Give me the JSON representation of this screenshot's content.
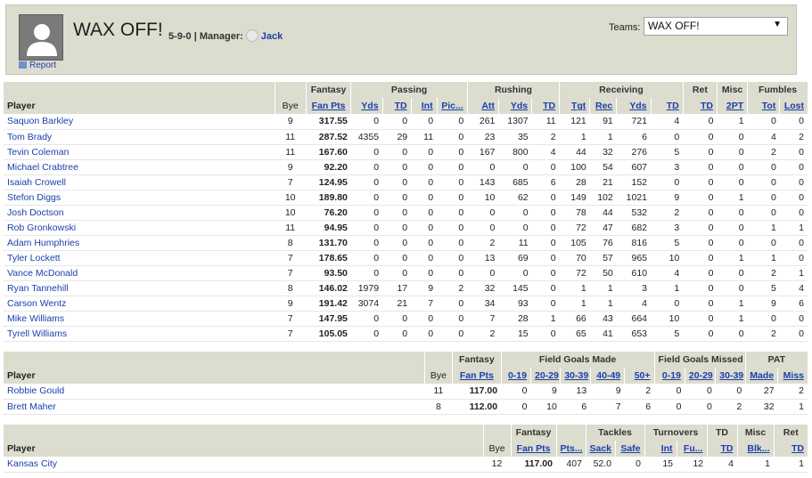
{
  "header": {
    "team_name": "WAX OFF!",
    "record": "5-9-0",
    "manager_label": "Manager:",
    "manager_name": "Jack",
    "report_label": "Report",
    "teams_label": "Teams:",
    "teams_selected": "WAX OFF!"
  },
  "offense": {
    "groups": [
      "Fantasy",
      "Passing",
      "Rushing",
      "Receiving",
      "Ret",
      "Misc",
      "Fumbles"
    ],
    "columns": [
      "Player",
      "Bye",
      "Fan Pts",
      "Yds",
      "TD",
      "Int",
      "Pic...",
      "Att",
      "Yds",
      "TD",
      "Tgt",
      "Rec",
      "Yds",
      "TD",
      "TD",
      "2PT",
      "Tot",
      "Lost"
    ],
    "rows": [
      [
        "Saquon Barkley",
        "9",
        "317.55",
        "0",
        "0",
        "0",
        "0",
        "261",
        "1307",
        "11",
        "121",
        "91",
        "721",
        "4",
        "0",
        "1",
        "0",
        "0"
      ],
      [
        "Tom Brady",
        "11",
        "287.52",
        "4355",
        "29",
        "11",
        "0",
        "23",
        "35",
        "2",
        "1",
        "1",
        "6",
        "0",
        "0",
        "0",
        "4",
        "2"
      ],
      [
        "Tevin Coleman",
        "11",
        "167.60",
        "0",
        "0",
        "0",
        "0",
        "167",
        "800",
        "4",
        "44",
        "32",
        "276",
        "5",
        "0",
        "0",
        "2",
        "0"
      ],
      [
        "Michael Crabtree",
        "9",
        "92.20",
        "0",
        "0",
        "0",
        "0",
        "0",
        "0",
        "0",
        "100",
        "54",
        "607",
        "3",
        "0",
        "0",
        "0",
        "0"
      ],
      [
        "Isaiah Crowell",
        "7",
        "124.95",
        "0",
        "0",
        "0",
        "0",
        "143",
        "685",
        "6",
        "28",
        "21",
        "152",
        "0",
        "0",
        "0",
        "0",
        "0"
      ],
      [
        "Stefon Diggs",
        "10",
        "189.80",
        "0",
        "0",
        "0",
        "0",
        "10",
        "62",
        "0",
        "149",
        "102",
        "1021",
        "9",
        "0",
        "1",
        "0",
        "0"
      ],
      [
        "Josh Doctson",
        "10",
        "76.20",
        "0",
        "0",
        "0",
        "0",
        "0",
        "0",
        "0",
        "78",
        "44",
        "532",
        "2",
        "0",
        "0",
        "0",
        "0"
      ],
      [
        "Rob Gronkowski",
        "11",
        "94.95",
        "0",
        "0",
        "0",
        "0",
        "0",
        "0",
        "0",
        "72",
        "47",
        "682",
        "3",
        "0",
        "0",
        "1",
        "1"
      ],
      [
        "Adam Humphries",
        "8",
        "131.70",
        "0",
        "0",
        "0",
        "0",
        "2",
        "11",
        "0",
        "105",
        "76",
        "816",
        "5",
        "0",
        "0",
        "0",
        "0"
      ],
      [
        "Tyler Lockett",
        "7",
        "178.65",
        "0",
        "0",
        "0",
        "0",
        "13",
        "69",
        "0",
        "70",
        "57",
        "965",
        "10",
        "0",
        "1",
        "1",
        "0"
      ],
      [
        "Vance McDonald",
        "7",
        "93.50",
        "0",
        "0",
        "0",
        "0",
        "0",
        "0",
        "0",
        "72",
        "50",
        "610",
        "4",
        "0",
        "0",
        "2",
        "1"
      ],
      [
        "Ryan Tannehill",
        "8",
        "146.02",
        "1979",
        "17",
        "9",
        "2",
        "32",
        "145",
        "0",
        "1",
        "1",
        "3",
        "1",
        "0",
        "0",
        "5",
        "4"
      ],
      [
        "Carson Wentz",
        "9",
        "191.42",
        "3074",
        "21",
        "7",
        "0",
        "34",
        "93",
        "0",
        "1",
        "1",
        "4",
        "0",
        "0",
        "1",
        "9",
        "6"
      ],
      [
        "Mike Williams",
        "7",
        "147.95",
        "0",
        "0",
        "0",
        "0",
        "7",
        "28",
        "1",
        "66",
        "43",
        "664",
        "10",
        "0",
        "1",
        "0",
        "0"
      ],
      [
        "Tyrell Williams",
        "7",
        "105.05",
        "0",
        "0",
        "0",
        "0",
        "2",
        "15",
        "0",
        "65",
        "41",
        "653",
        "5",
        "0",
        "0",
        "2",
        "0"
      ]
    ]
  },
  "kickers": {
    "groups": [
      "Fantasy",
      "Field Goals Made",
      "Field Goals Missed",
      "PAT"
    ],
    "columns": [
      "Player",
      "Bye",
      "Fan Pts",
      "0-19",
      "20-29",
      "30-39",
      "40-49",
      "50+",
      "0-19",
      "20-29",
      "30-39",
      "Made",
      "Miss"
    ],
    "rows": [
      [
        "Robbie Gould",
        "11",
        "117.00",
        "0",
        "9",
        "13",
        "9",
        "2",
        "0",
        "0",
        "0",
        "27",
        "2"
      ],
      [
        "Brett Maher",
        "8",
        "112.00",
        "0",
        "10",
        "6",
        "7",
        "6",
        "0",
        "0",
        "2",
        "32",
        "1"
      ]
    ]
  },
  "defense": {
    "groups": [
      "Fantasy",
      "Tackles",
      "Turnovers",
      "TD",
      "Misc",
      "Ret"
    ],
    "columns": [
      "Player",
      "Bye",
      "Fan Pts",
      "Pts...",
      "Sack",
      "Safe",
      "Int",
      "Fu...",
      "TD",
      "Blk...",
      "TD"
    ],
    "rows": [
      [
        "Kansas City",
        "12",
        "117.00",
        "407",
        "52.0",
        "0",
        "15",
        "12",
        "4",
        "1",
        "1"
      ]
    ]
  }
}
